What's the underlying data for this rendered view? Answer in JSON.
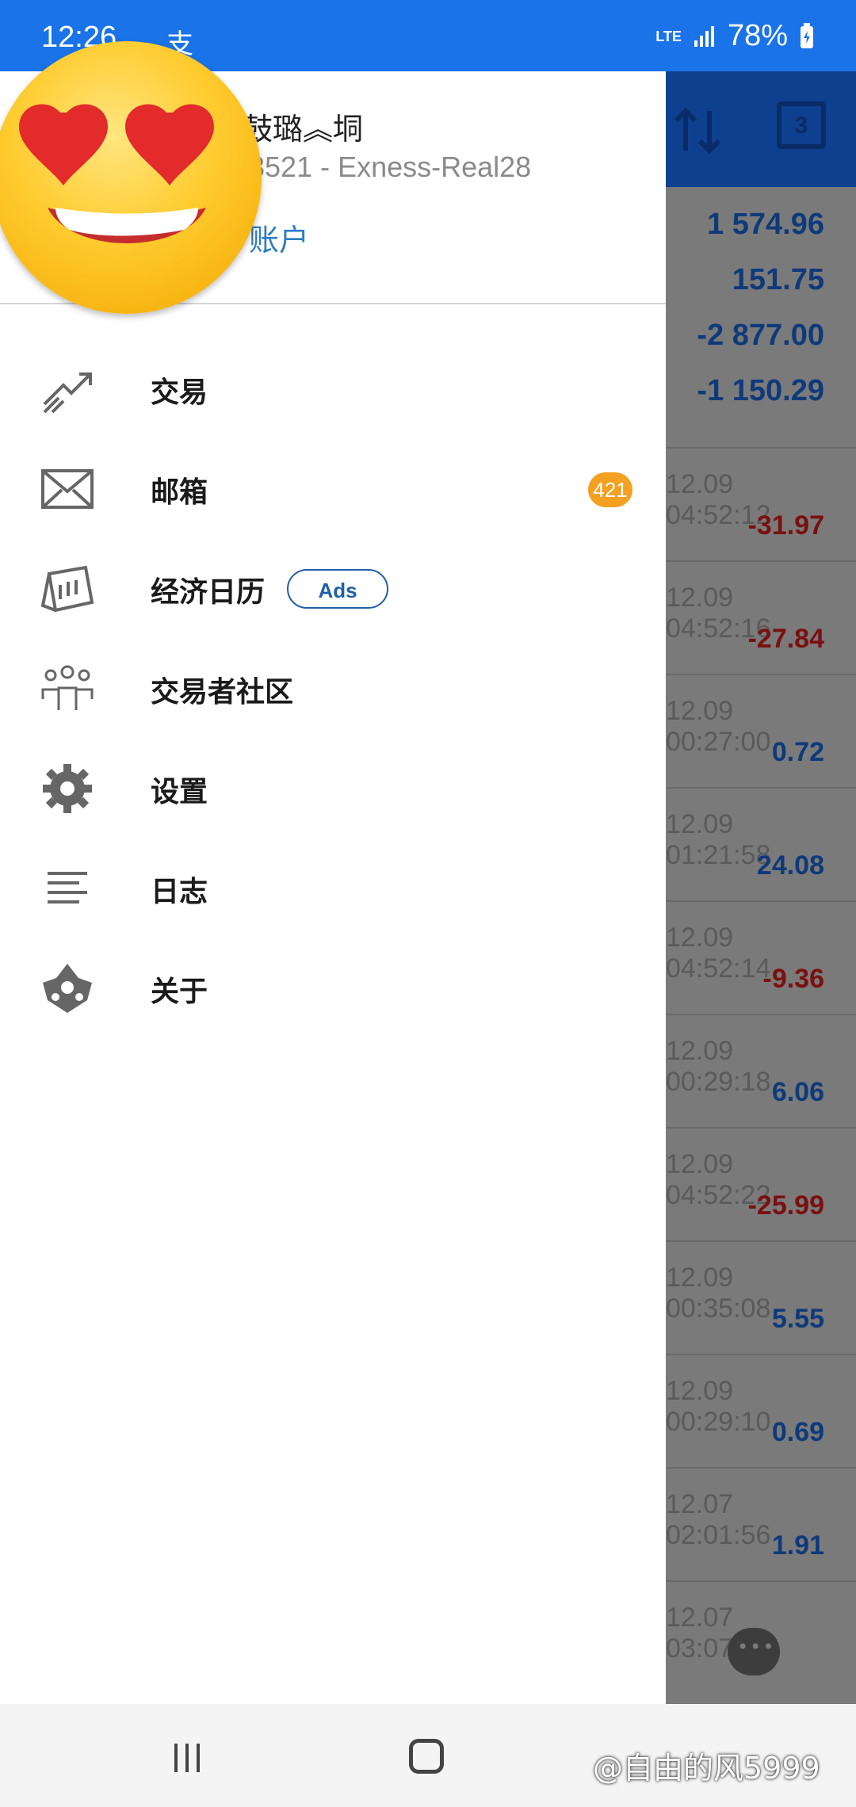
{
  "status_bar": {
    "time": "12:26",
    "notif_icon": "支",
    "network": "LTE",
    "battery": "78%"
  },
  "app_header": {
    "calendar_day": "3"
  },
  "summary": [
    "1 574.96",
    "151.75",
    "-2 877.00",
    "-1 150.29"
  ],
  "trades": [
    {
      "date": "12.09 04:52:12",
      "value": "-31.97",
      "sign": "neg"
    },
    {
      "date": "12.09 04:52:16",
      "value": "-27.84",
      "sign": "neg"
    },
    {
      "date": "12.09 00:27:00",
      "value": "0.72",
      "sign": "pos"
    },
    {
      "date": "12.09 01:21:58",
      "value": "24.08",
      "sign": "pos"
    },
    {
      "date": "12.09 04:52:14",
      "value": "-9.36",
      "sign": "neg"
    },
    {
      "date": "12.09 00:29:18",
      "value": "6.06",
      "sign": "pos"
    },
    {
      "date": "12.09 04:52:22",
      "value": "-25.99",
      "sign": "neg"
    },
    {
      "date": "12.09 00:35:08",
      "value": "5.55",
      "sign": "pos"
    },
    {
      "date": "12.09 00:29:10",
      "value": "0.69",
      "sign": "pos"
    },
    {
      "date": "12.07 02:01:56",
      "value": "1.91",
      "sign": "pos"
    },
    {
      "date": "12.07 03:07:54",
      "value": "",
      "sign": "pos"
    }
  ],
  "drawer": {
    "account_name": "鼓璐︽垌",
    "account_number": "3521 - Exness-Real28",
    "manage_link": "账户",
    "menu": [
      {
        "label": "交易",
        "icon": "trade-chart-icon"
      },
      {
        "label": "邮箱",
        "icon": "mail-icon",
        "badge": "421"
      },
      {
        "label": "经济日历",
        "icon": "calendar-icon",
        "tag": "Ads"
      },
      {
        "label": "交易者社区",
        "icon": "community-icon"
      },
      {
        "label": "设置",
        "icon": "gear-icon"
      },
      {
        "label": "日志",
        "icon": "journal-icon"
      },
      {
        "label": "关于",
        "icon": "about-logo-icon"
      }
    ]
  },
  "nav": {
    "watermark": "@自由的风5999"
  }
}
